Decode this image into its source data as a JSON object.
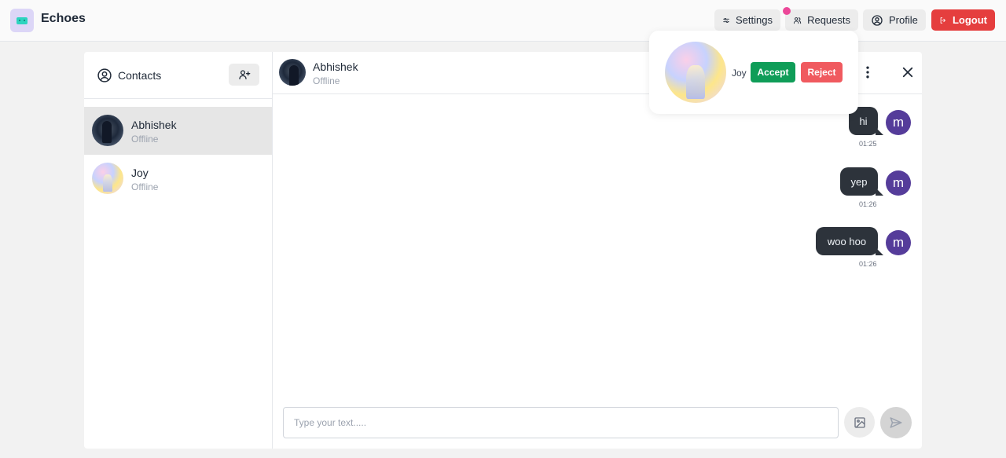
{
  "app": {
    "title": "Echoes",
    "logo_icon": "robot-logo-icon"
  },
  "topnav": {
    "settings_label": "Settings",
    "requests_label": "Requests",
    "profile_label": "Profile",
    "logout_label": "Logout",
    "logout_color": "#e53e3e",
    "notification_color": "#ec4899"
  },
  "sidebar": {
    "title": "Contacts",
    "contacts": [
      {
        "name": "Abhishek",
        "status": "Offline",
        "active": true
      },
      {
        "name": "Joy",
        "status": "Offline",
        "active": false
      }
    ]
  },
  "chat": {
    "contact_name": "Abhishek",
    "contact_status": "Offline",
    "messages": [
      {
        "text": "hi",
        "time": "01:25",
        "avatar_letter": "m"
      },
      {
        "text": "yep",
        "time": "01:26",
        "avatar_letter": "m"
      },
      {
        "text": "woo hoo",
        "time": "01:26",
        "avatar_letter": "m"
      }
    ],
    "composer_placeholder": "Type your text.....",
    "bubble_color": "#2d333b",
    "avatar_color": "#553c9a"
  },
  "request_popover": {
    "name": "Joy",
    "accept_label": "Accept",
    "reject_label": "Reject",
    "accept_color": "#0f9d58",
    "reject_color": "#f05a5f"
  }
}
